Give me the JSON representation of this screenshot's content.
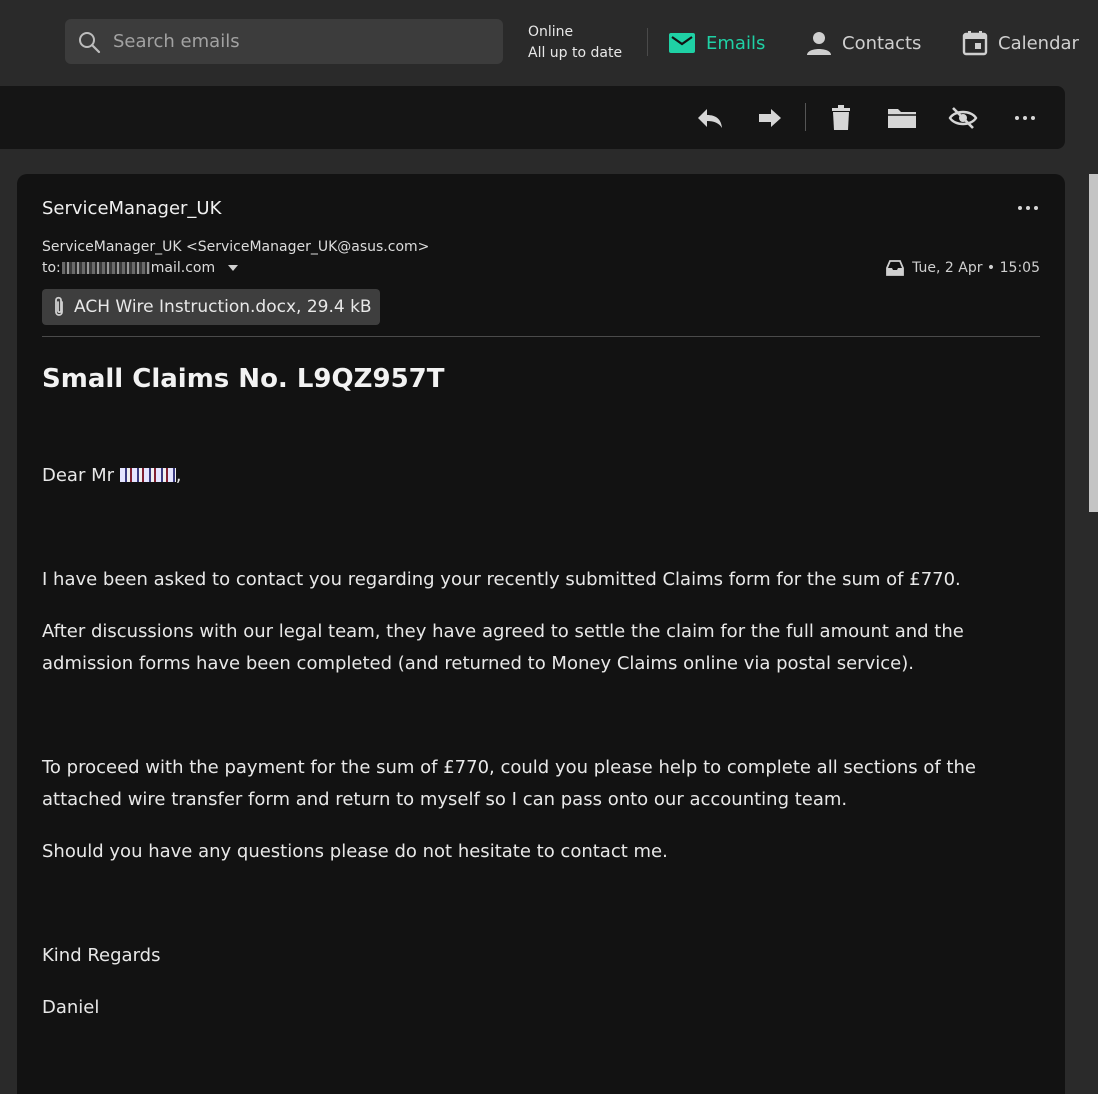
{
  "search": {
    "placeholder": "Search emails"
  },
  "status": {
    "line1": "Online",
    "line2": "All up to date"
  },
  "nav": {
    "emails": "Emails",
    "contacts": "Contacts",
    "calendar": "Calendar"
  },
  "colors": {
    "accent": "#1fd1a5",
    "background": "#2a2a2a",
    "panel": "#121212",
    "toolbar": "#151515"
  },
  "email": {
    "sender_name": "ServiceManager_UK",
    "from": "ServiceManager_UK <ServiceManager_UK@asus.com>",
    "to_label": "to:",
    "to_domain": "mail.com",
    "date": "Tue, 2 Apr • 15:05",
    "attachment": "ACH Wire Instruction.docx, 29.4 kB",
    "subject": "Small Claims No. L9QZ957T",
    "greeting": "Dear Mr",
    "greeting_end": ",",
    "paragraphs": [
      "I have been asked to contact you regarding your recently submitted Claims form for the sum of £770.",
      "After discussions with our legal team, they have agreed to settle the claim for the full amount and the admission forms have been completed (and returned to Money Claims online via postal service).",
      "To proceed with the payment for the sum of £770, could you please help to complete all sections of the attached wire transfer form and return to myself so I can pass onto our accounting team.",
      "Should you have any questions please do not hesitate to contact me.",
      "Kind Regards",
      "Daniel"
    ]
  }
}
